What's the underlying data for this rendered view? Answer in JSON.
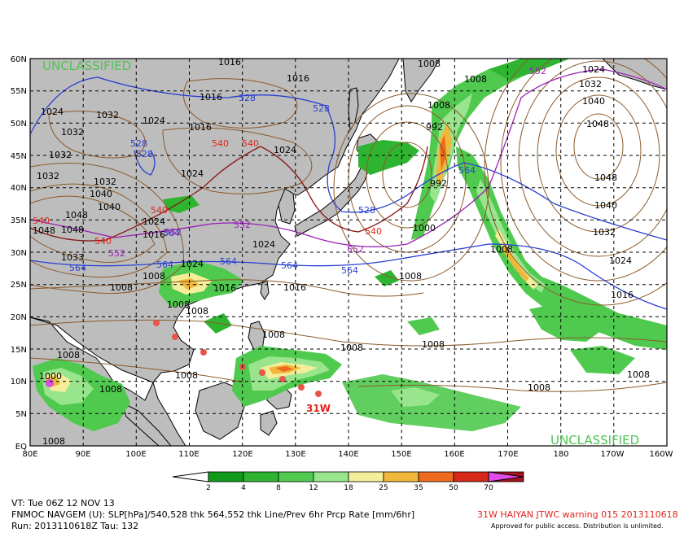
{
  "map": {
    "lat_labels": [
      "60N",
      "55N",
      "50N",
      "45N",
      "40N",
      "35N",
      "30N",
      "25N",
      "20N",
      "15N",
      "10N",
      "5N",
      "EQ"
    ],
    "lon_labels": [
      "80E",
      "90E",
      "100E",
      "110E",
      "120E",
      "130E",
      "140E",
      "150E",
      "160E",
      "170E",
      "180",
      "170W",
      "160W"
    ],
    "classification": "UNCLASSIFIED",
    "storm_label": "31W",
    "isobar_labels": [
      {
        "text": "1016",
        "c": "#000"
      },
      {
        "text": "1016",
        "c": "#000"
      },
      {
        "text": "1016",
        "c": "#000"
      },
      {
        "text": "1024",
        "c": "#000"
      },
      {
        "text": "1032",
        "c": "#000"
      },
      {
        "text": "1024",
        "c": "#000"
      },
      {
        "text": "1032",
        "c": "#000"
      },
      {
        "text": "1032",
        "c": "#000"
      },
      {
        "text": "1016",
        "c": "#000"
      },
      {
        "text": "1024",
        "c": "#000"
      },
      {
        "text": "1024",
        "c": "#000"
      },
      {
        "text": "1032",
        "c": "#000"
      },
      {
        "text": "1040",
        "c": "#000"
      },
      {
        "text": "1032",
        "c": "#000"
      },
      {
        "text": "1048",
        "c": "#000"
      },
      {
        "text": "1040",
        "c": "#000"
      },
      {
        "text": "1048",
        "c": "#000"
      },
      {
        "text": "1048",
        "c": "#000"
      },
      {
        "text": "1024",
        "c": "#000"
      },
      {
        "text": "1016",
        "c": "#000"
      },
      {
        "text": "1033",
        "c": "#000"
      },
      {
        "text": "1024",
        "c": "#000"
      },
      {
        "text": "1024",
        "c": "#000"
      },
      {
        "text": "1008",
        "c": "#000"
      },
      {
        "text": "1008",
        "c": "#000"
      },
      {
        "text": "1016",
        "c": "#000"
      },
      {
        "text": "1016",
        "c": "#000"
      },
      {
        "text": "1008",
        "c": "#000"
      },
      {
        "text": "1008",
        "c": "#000"
      },
      {
        "text": "1008",
        "c": "#000"
      },
      {
        "text": "1008",
        "c": "#000"
      },
      {
        "text": "1000",
        "c": "#000"
      },
      {
        "text": "1008",
        "c": "#000"
      },
      {
        "text": "1008",
        "c": "#000"
      },
      {
        "text": "1008",
        "c": "#000"
      },
      {
        "text": "1008",
        "c": "#000"
      },
      {
        "text": "1008",
        "c": "#000"
      },
      {
        "text": "1008",
        "c": "#000"
      },
      {
        "text": "992",
        "c": "#000"
      },
      {
        "text": "992",
        "c": "#000"
      },
      {
        "text": "1000",
        "c": "#000"
      },
      {
        "text": "1008",
        "c": "#000"
      },
      {
        "text": "1008",
        "c": "#000"
      },
      {
        "text": "1024",
        "c": "#000"
      },
      {
        "text": "1032",
        "c": "#000"
      },
      {
        "text": "1040",
        "c": "#000"
      },
      {
        "text": "1048",
        "c": "#000"
      },
      {
        "text": "1048",
        "c": "#000"
      },
      {
        "text": "1040",
        "c": "#000"
      },
      {
        "text": "1032",
        "c": "#000"
      },
      {
        "text": "1024",
        "c": "#000"
      },
      {
        "text": "1016",
        "c": "#000"
      },
      {
        "text": "1008",
        "c": "#000"
      },
      {
        "text": "1008",
        "c": "#000"
      },
      {
        "text": "1008",
        "c": "#000"
      },
      {
        "text": "1008",
        "c": "#000"
      }
    ],
    "thickness_labels": [
      {
        "text": "528",
        "c": "#2a3fd0"
      },
      {
        "text": "528",
        "c": "#2a3fd0"
      },
      {
        "text": "528",
        "c": "#2a3fd0"
      },
      {
        "text": "528",
        "c": "#2a3fd0"
      },
      {
        "text": "528",
        "c": "#2a3fd0"
      },
      {
        "text": "564",
        "c": "#2a3fd0"
      },
      {
        "text": "564",
        "c": "#2a3fd0"
      },
      {
        "text": "564",
        "c": "#2a3fd0"
      },
      {
        "text": "564",
        "c": "#2a3fd0"
      },
      {
        "text": "564",
        "c": "#2a3fd0"
      },
      {
        "text": "564",
        "c": "#2a3fd0"
      },
      {
        "text": "564",
        "c": "#2a3fd0"
      },
      {
        "text": "540",
        "c": "#e0241b"
      },
      {
        "text": "540",
        "c": "#e0241b"
      },
      {
        "text": "540",
        "c": "#e0241b"
      },
      {
        "text": "540",
        "c": "#e0241b"
      },
      {
        "text": "540",
        "c": "#e0241b"
      },
      {
        "text": "540",
        "c": "#e0241b"
      },
      {
        "text": "552",
        "c": "#9a1fb5"
      },
      {
        "text": "552",
        "c": "#9a1fb5"
      },
      {
        "text": "552",
        "c": "#9a1fb5"
      },
      {
        "text": "552",
        "c": "#9a1fb5"
      },
      {
        "text": "552",
        "c": "#9a1fb5"
      }
    ]
  },
  "colorbar": {
    "levels": [
      "2",
      "4",
      "8",
      "12",
      "18",
      "25",
      "35",
      "50",
      "70"
    ],
    "colors": [
      "#0f9a1c",
      "#2fb431",
      "#50c94f",
      "#98e58d",
      "#f4ee9a",
      "#f0b83a",
      "#ee6a1d",
      "#d62a18",
      "#a8101a",
      "#7a0c19",
      "#e04ce8"
    ]
  },
  "footer": {
    "line1": "VT: Tue 06Z 12 NOV 13",
    "line2": "FNMOC NAVGEM (U): SLP[hPa]/540,528 thk 564,552 thk Line/Prev 6hr Prcp Rate [mm/6hr]",
    "line3": "Run: 2013110618Z Tau: 132",
    "warning": "31W HAIYAN JTWC warning 015 2013110618",
    "approved": "Approved for public access. Distribution is unlimited."
  }
}
